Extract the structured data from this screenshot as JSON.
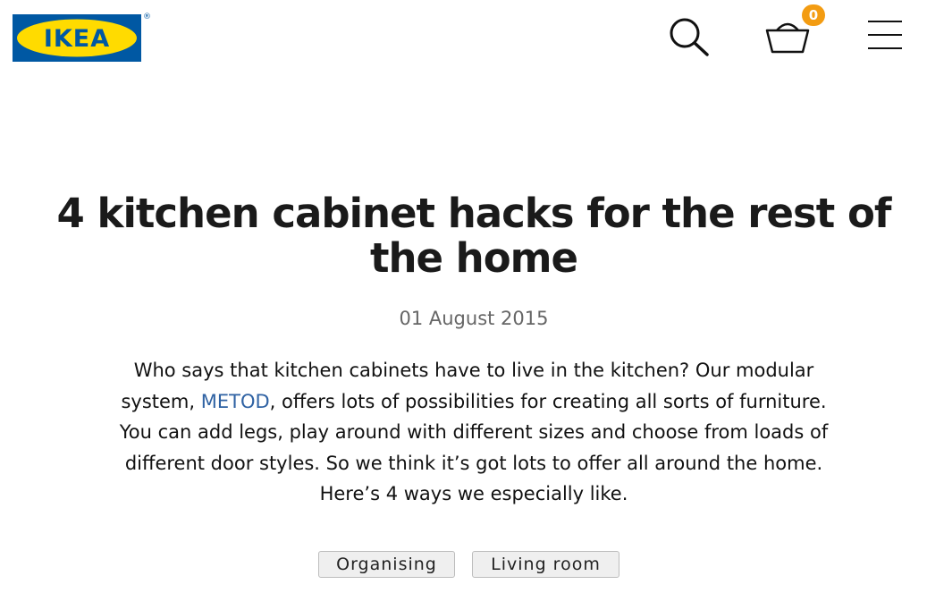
{
  "header": {
    "logo_text": "IKEA",
    "logo_registered": "®",
    "basket_count": "0",
    "icons": [
      "search-icon",
      "basket-icon",
      "hamburger-menu-icon"
    ],
    "colors": {
      "logo_blue": "#0058a3",
      "logo_yellow": "#ffdb00",
      "badge": "#f39c12"
    }
  },
  "article": {
    "title": "4 kitchen cabinet hacks for the rest of the home",
    "date": "01 August 2015",
    "body_before_link": "Who says that kitchen cabinets have to live in the kitchen? Our modular system, ",
    "body_link": "METOD",
    "body_after_link": ", offers lots of possibilities for creating all sorts of furniture. You can add legs, play around with different sizes and choose from loads of different door styles. So we think it’s got lots to offer all around the home. Here’s 4 ways we especially like.",
    "link_color": "#2f62a3"
  },
  "tags": [
    {
      "label": "Organising"
    },
    {
      "label": "Living room"
    }
  ]
}
